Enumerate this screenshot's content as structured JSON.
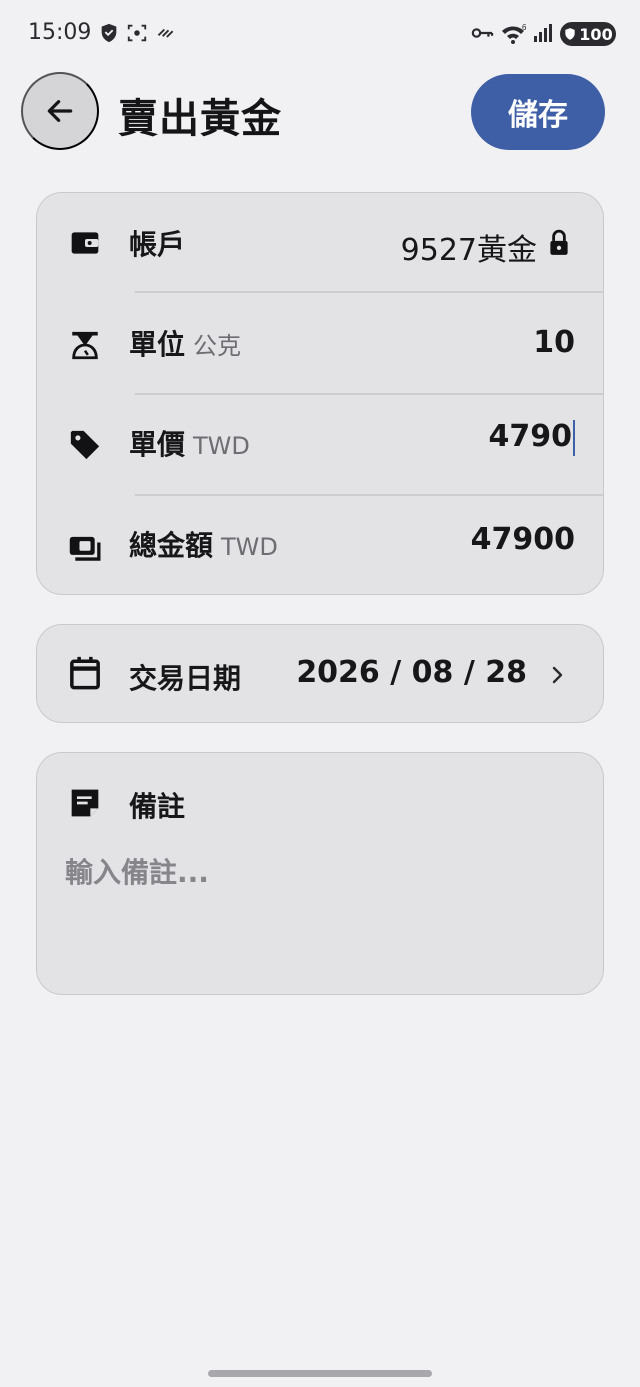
{
  "status_bar": {
    "time": "15:09",
    "battery": "100",
    "icons": [
      "shield-icon",
      "screenshot-icon",
      "signal-slash-icon",
      "key-icon",
      "wifi-6-icon",
      "cell-signal-icon"
    ]
  },
  "header": {
    "title": "賣出黃金",
    "save_label": "儲存",
    "back_icon": "arrow-left-icon"
  },
  "form": {
    "account": {
      "label": "帳戶",
      "value": "9527黃金",
      "icon": "wallet-icon",
      "locked_icon": "lock-icon"
    },
    "unit": {
      "label": "單位",
      "unit": "公克",
      "value": "10",
      "icon": "scale-icon"
    },
    "price": {
      "label": "單價",
      "unit": "TWD",
      "value": "4790",
      "icon": "tag-icon"
    },
    "total": {
      "label": "總金額",
      "unit": "TWD",
      "value": "47900",
      "icon": "money-icon"
    }
  },
  "date": {
    "label": "交易日期",
    "value": "2026 / 08 / 28",
    "icon": "calendar-icon",
    "chevron": "chevron-right-icon"
  },
  "note": {
    "label": "備註",
    "placeholder": "輸入備註...",
    "icon": "note-icon"
  },
  "colors": {
    "accent": "#3e5ea6",
    "background": "#f1f1f3",
    "card": "#e3e3e6"
  }
}
